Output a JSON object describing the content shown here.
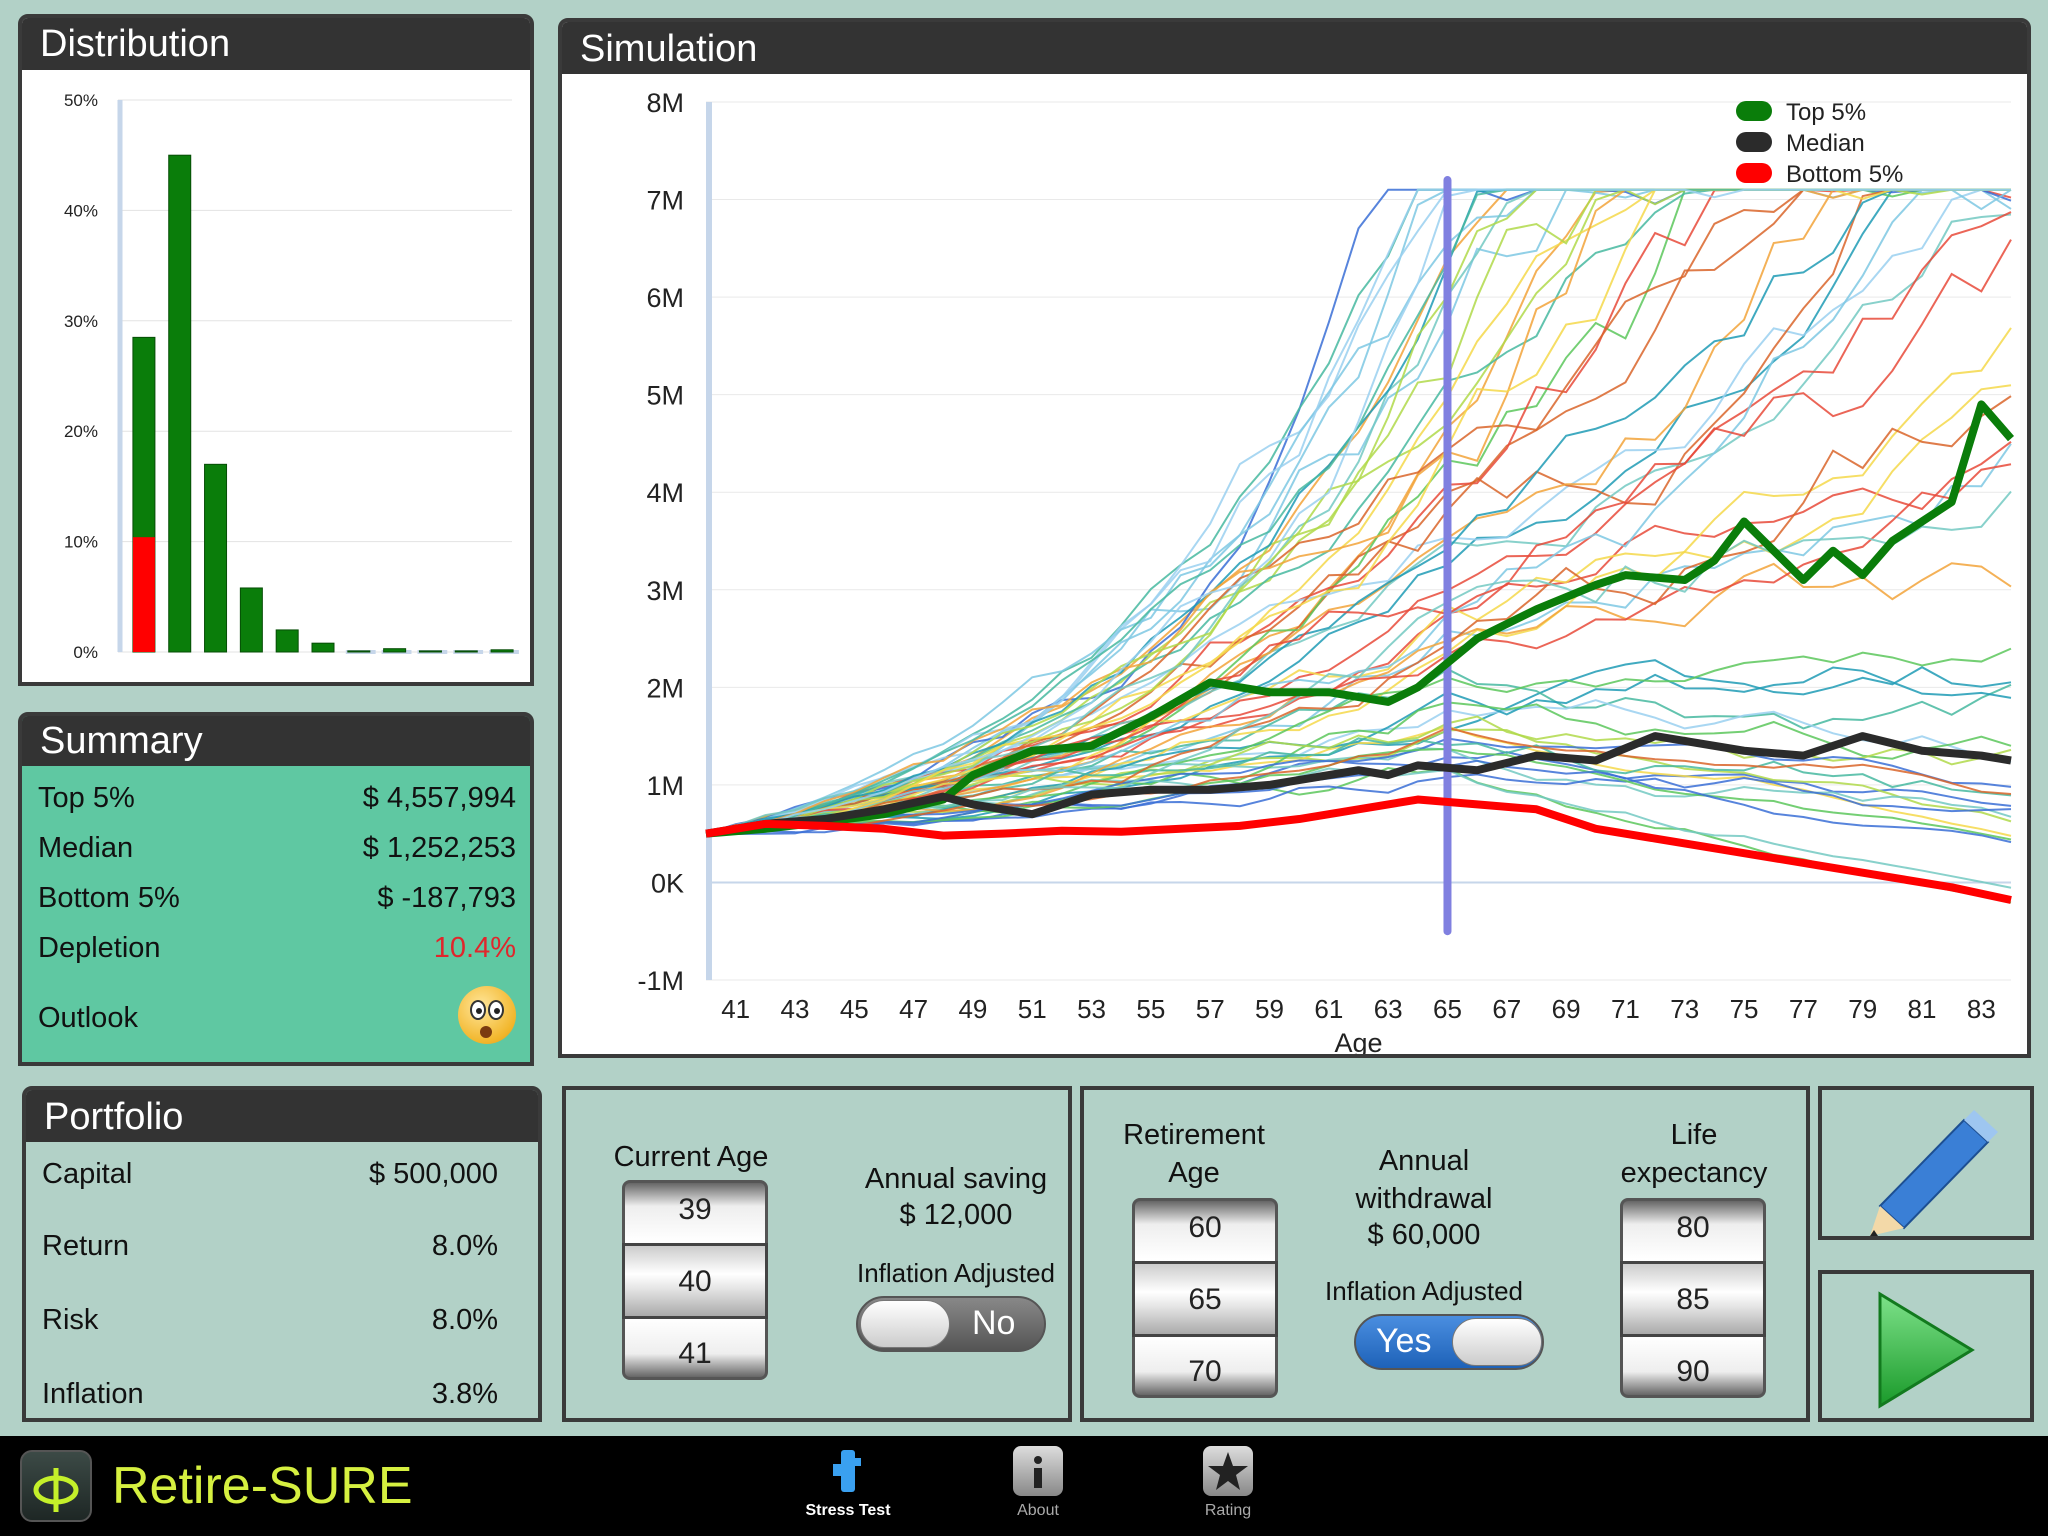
{
  "panels": {
    "distribution": "Distribution",
    "simulation": "Simulation",
    "summary": "Summary",
    "portfolio": "Portfolio"
  },
  "summary": {
    "rows": [
      {
        "label": "Top 5%",
        "value": "$ 4,557,994"
      },
      {
        "label": "Median",
        "value": "$ 1,252,253"
      },
      {
        "label": "Bottom 5%",
        "value": "$ -187,793"
      },
      {
        "label": "Depletion",
        "value": "10.4%"
      },
      {
        "label": "Outlook",
        "value": ""
      }
    ],
    "outlook_icon": "surprised-face-icon"
  },
  "portfolio": {
    "rows": [
      {
        "label": "Capital",
        "value": "$ 500,000"
      },
      {
        "label": "Return",
        "value": "8.0%"
      },
      {
        "label": "Risk",
        "value": "8.0%"
      },
      {
        "label": "Inflation",
        "value": "3.8%"
      }
    ]
  },
  "controls": {
    "current_age_label": "Current Age",
    "current_age_options": [
      "39",
      "40",
      "41"
    ],
    "current_age_selected": "40",
    "annual_saving_label": "Annual saving",
    "annual_saving_value": "$ 12,000",
    "saving_inflation_label": "Inflation Adjusted",
    "saving_inflation_toggle": "No",
    "retirement_age_label_1": "Retirement",
    "retirement_age_label_2": "Age",
    "retirement_age_options": [
      "60",
      "65",
      "70"
    ],
    "retirement_age_selected": "65",
    "withdrawal_label_1": "Annual",
    "withdrawal_label_2": "withdrawal",
    "withdrawal_value": "$ 60,000",
    "withdrawal_inflation_label": "Inflation Adjusted",
    "withdrawal_inflation_toggle": "Yes",
    "life_expectancy_label_1": "Life",
    "life_expectancy_label_2": "expectancy",
    "life_expectancy_options": [
      "80",
      "85",
      "90"
    ],
    "life_expectancy_selected": "85"
  },
  "tabbar": {
    "app_name": "Retire-SURE",
    "tabs": [
      {
        "label": "Stress Test",
        "icon": "stress-test-icon",
        "active": true
      },
      {
        "label": "About",
        "icon": "info-icon",
        "active": false
      },
      {
        "label": "Rating",
        "icon": "star-icon",
        "active": false
      }
    ]
  },
  "colors": {
    "green": "#0a7d0a",
    "red": "#ff0000",
    "median": "#2b2b2b",
    "retire_marker": "#8080e0",
    "panel_bg": "#b2d1c7",
    "summary_bg": "#5fc8a2"
  },
  "chart_data": [
    {
      "type": "bar",
      "ylim": [
        0,
        50
      ],
      "y_ticks": [
        "0%",
        "10%",
        "20%",
        "30%",
        "40%",
        "50%"
      ],
      "series": [
        {
          "values": [
            28.5,
            45,
            17,
            5.8,
            2,
            0.8,
            0.1,
            0.3,
            0.1,
            0.1,
            0.2
          ]
        },
        {
          "values": [
            10.4,
            0,
            0,
            0,
            0,
            0,
            0,
            0,
            0,
            0,
            0
          ]
        }
      ]
    },
    {
      "type": "line",
      "xlabel": "Age",
      "x_ticks": [
        "41",
        "43",
        "45",
        "47",
        "49",
        "51",
        "53",
        "55",
        "57",
        "59",
        "61",
        "63",
        "65",
        "67",
        "69",
        "71",
        "73",
        "75",
        "77",
        "79",
        "81",
        "83"
      ],
      "y_ticks": [
        "-1M",
        "0K",
        "1M",
        "2M",
        "3M",
        "4M",
        "5M",
        "6M",
        "7M",
        "8M"
      ],
      "ylim": [
        -1000000,
        8000000
      ],
      "xlim": [
        40,
        84
      ],
      "retirement_marker_age": 65,
      "legend": [
        "Top 5%",
        "Median",
        "Bottom 5%"
      ],
      "legend_position": "top-right",
      "series": [
        {
          "name": "Top 5%",
          "x": [
            40,
            42,
            44,
            46,
            48,
            49,
            51,
            53,
            55,
            57,
            59,
            61,
            63,
            64,
            66,
            68,
            70,
            71,
            73,
            74,
            75,
            77,
            78,
            79,
            80,
            82,
            83,
            84
          ],
          "y": [
            500000,
            550000,
            620000,
            700000,
            850000,
            1100000,
            1350000,
            1400000,
            1700000,
            2050000,
            1950000,
            1950000,
            1850000,
            2000000,
            2500000,
            2800000,
            3050000,
            3150000,
            3100000,
            3300000,
            3700000,
            3100000,
            3400000,
            3150000,
            3500000,
            3900000,
            4900000,
            4550000
          ]
        },
        {
          "name": "Median",
          "x": [
            40,
            42,
            44,
            46,
            48,
            49,
            51,
            53,
            55,
            57,
            59,
            61,
            62,
            63,
            64,
            66,
            68,
            70,
            72,
            73,
            75,
            77,
            79,
            81,
            83,
            84
          ],
          "y": [
            500000,
            600000,
            650000,
            750000,
            880000,
            800000,
            700000,
            900000,
            950000,
            950000,
            1000000,
            1100000,
            1150000,
            1100000,
            1200000,
            1150000,
            1300000,
            1250000,
            1500000,
            1450000,
            1350000,
            1300000,
            1500000,
            1350000,
            1300000,
            1250000
          ]
        },
        {
          "name": "Bottom 5%",
          "x": [
            40,
            42,
            44,
            46,
            48,
            50,
            52,
            54,
            56,
            58,
            60,
            62,
            64,
            66,
            68,
            70,
            72,
            74,
            76,
            78,
            80,
            82,
            84
          ],
          "y": [
            500000,
            600000,
            580000,
            550000,
            480000,
            500000,
            530000,
            520000,
            550000,
            580000,
            650000,
            750000,
            850000,
            800000,
            750000,
            550000,
            450000,
            350000,
            250000,
            150000,
            50000,
            -50000,
            -180000
          ]
        }
      ]
    }
  ]
}
